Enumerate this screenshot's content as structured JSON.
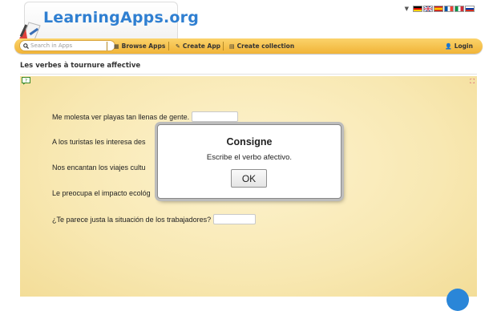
{
  "header": {
    "logo_text": "LearningApps.org",
    "languages": [
      "de",
      "en",
      "es",
      "fr",
      "it",
      "ru"
    ]
  },
  "navbar": {
    "search_placeholder": "Search in Apps",
    "browse_label": "Browse Apps",
    "create_app_label": "Create App",
    "create_collection_label": "Create collection",
    "login_label": "Login"
  },
  "page": {
    "title": "Les verbes à tournure affective"
  },
  "exercise": {
    "sentences": [
      {
        "text": "Me molesta ver playas tan llenas de gente.",
        "answer": ""
      },
      {
        "text": "A los turistas les interesa des",
        "answer": ""
      },
      {
        "text": "Nos encantan los viajes cultu",
        "answer": ""
      },
      {
        "text": "Le preocupa el impacto ecológ",
        "answer": ""
      },
      {
        "text": "¿Te parece justa la situación de los trabajadores?",
        "answer": ""
      }
    ]
  },
  "dialog": {
    "title": "Consigne",
    "message": "Escribe el verbo afectivo.",
    "ok_label": "OK"
  },
  "colors": {
    "navbar": "#f1b437",
    "logo_blue": "#2f7fd1",
    "stage_bg": "#f8e8b2",
    "action_button": "#2a86d8"
  }
}
